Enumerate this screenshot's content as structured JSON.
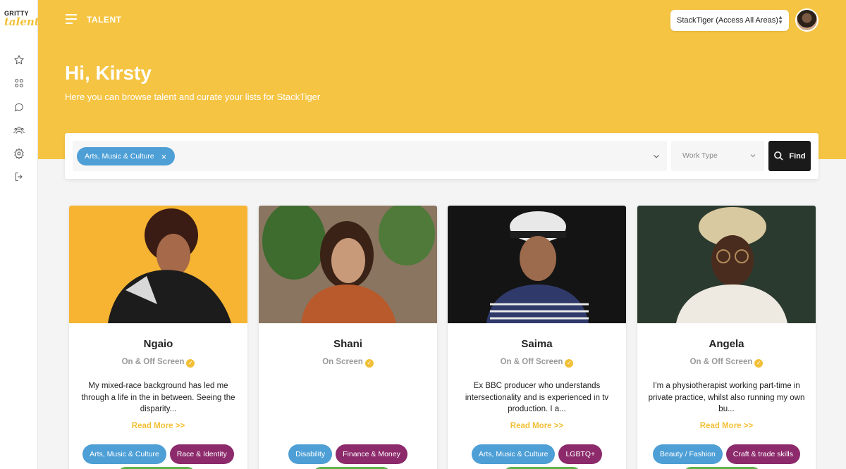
{
  "brand": {
    "line1": "GRITTY",
    "line2": "talent"
  },
  "sidebar": {
    "icons": [
      "star-icon",
      "grid-icon",
      "chat-icon",
      "team-icon",
      "settings-icon",
      "logout-icon"
    ]
  },
  "header": {
    "section_title": "TALENT",
    "org_selector": "StackTiger (Access All Areas)"
  },
  "hero": {
    "greeting": "Hi, Kirsty",
    "subtitle": "Here you can browse talent and curate your lists for StackTiger"
  },
  "search": {
    "selected_tag": "Arts, Music & Culture",
    "work_type_placeholder": "Work Type",
    "find_label": "Find"
  },
  "colors": {
    "brand_yellow": "#f5c443",
    "tag_blue": "#4d9fd6",
    "tag_purple": "#8c2a6b",
    "tag_green": "#5fb34a"
  },
  "cards": [
    {
      "name": "Ngaio",
      "role": "On & Off Screen",
      "bio": "My mixed-race background has led me through a life in the in between. Seeing the disparity...",
      "read_more": "Read More >>",
      "tags": [
        "Arts, Music & Culture",
        "Race & Identity"
      ]
    },
    {
      "name": "Shani",
      "role": "On Screen",
      "bio": "",
      "read_more": "",
      "tags": [
        "Disability",
        "Finance & Money"
      ]
    },
    {
      "name": "Saima",
      "role": "On & Off Screen",
      "bio": "Ex BBC producer who understands intersectionality and is experienced in tv production. I a...",
      "read_more": "Read More >>",
      "tags": [
        "Arts, Music & Culture",
        "LGBTQ+"
      ]
    },
    {
      "name": "Angela",
      "role": "On & Off Screen",
      "bio": "I'm a physiotherapist working part-time in private practice, whilst also running my own bu...",
      "read_more": "Read More >>",
      "tags": [
        "Beauty / Fashion",
        "Craft & trade skills"
      ]
    }
  ]
}
